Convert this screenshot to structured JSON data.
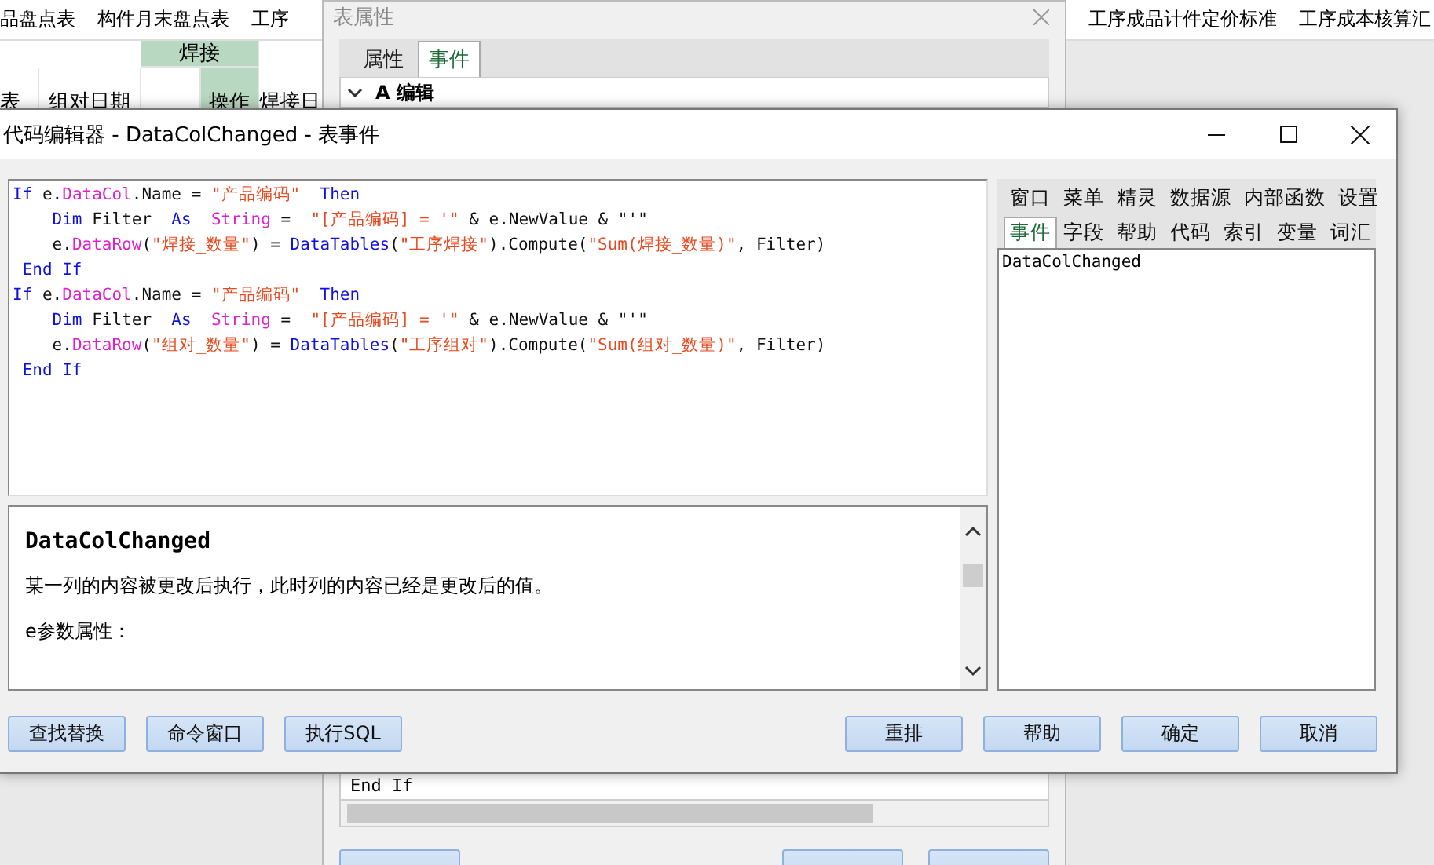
{
  "app_tabs": [
    "品盘点表",
    "构件月末盘点表",
    "工序",
    "工序成品计件定价标准",
    "工序成本核算汇"
  ],
  "grid_header": {
    "group": "焊接",
    "left_cut": "表",
    "col_date": "组对日期",
    "op": "操作",
    "weld_date": "焊接日"
  },
  "back_dialog": {
    "title": "表属性",
    "tabs": [
      {
        "label": "属性",
        "selected": false
      },
      {
        "label": "事件",
        "selected": true
      }
    ],
    "tree_item": "A 编辑",
    "code_tail": "End If"
  },
  "editor": {
    "title": "代码编辑器 - DataColChanged - 表事件",
    "code_lines": [
      [
        {
          "kind": "kw",
          "text": "If"
        },
        {
          "kind": "plain",
          "text": " e."
        },
        {
          "kind": "member",
          "text": "DataCol"
        },
        {
          "kind": "plain",
          "text": ".Name = "
        },
        {
          "kind": "str",
          "text": "\"产品编码\""
        },
        {
          "kind": "kw",
          "text": "  Then"
        }
      ],
      [
        {
          "kind": "kw",
          "text": "    Dim"
        },
        {
          "kind": "plain",
          "text": " Filter  "
        },
        {
          "kind": "kw",
          "text": "As"
        },
        {
          "kind": "member",
          "text": "  String"
        },
        {
          "kind": "plain",
          "text": " =  "
        },
        {
          "kind": "str",
          "text": "\"[产品编码] = '\""
        },
        {
          "kind": "plain",
          "text": " & e.NewValue & \"'\""
        }
      ],
      [
        {
          "kind": "plain",
          "text": "    e."
        },
        {
          "kind": "member",
          "text": "DataRow"
        },
        {
          "kind": "plain",
          "text": "("
        },
        {
          "kind": "str",
          "text": "\"焊接_数量\""
        },
        {
          "kind": "plain",
          "text": ") = "
        },
        {
          "kind": "kw",
          "text": "DataTables"
        },
        {
          "kind": "plain",
          "text": "("
        },
        {
          "kind": "str",
          "text": "\"工序焊接\""
        },
        {
          "kind": "plain",
          "text": ").Compute("
        },
        {
          "kind": "str",
          "text": "\"Sum(焊接_数量)\""
        },
        {
          "kind": "plain",
          "text": ", Filter)"
        }
      ],
      [
        {
          "kind": "kw",
          "text": " End If"
        }
      ],
      [
        {
          "kind": "kw",
          "text": "If"
        },
        {
          "kind": "plain",
          "text": " e."
        },
        {
          "kind": "member",
          "text": "DataCol"
        },
        {
          "kind": "plain",
          "text": ".Name = "
        },
        {
          "kind": "str",
          "text": "\"产品编码\""
        },
        {
          "kind": "kw",
          "text": "  Then"
        }
      ],
      [
        {
          "kind": "kw",
          "text": "    Dim"
        },
        {
          "kind": "plain",
          "text": " Filter  "
        },
        {
          "kind": "kw",
          "text": "As"
        },
        {
          "kind": "member",
          "text": "  String"
        },
        {
          "kind": "plain",
          "text": " =  "
        },
        {
          "kind": "str",
          "text": "\"[产品编码] = '\""
        },
        {
          "kind": "plain",
          "text": " & e.NewValue & \"'\""
        }
      ],
      [
        {
          "kind": "plain",
          "text": "    e."
        },
        {
          "kind": "member",
          "text": "DataRow"
        },
        {
          "kind": "plain",
          "text": "("
        },
        {
          "kind": "str",
          "text": "\"组对_数量\""
        },
        {
          "kind": "plain",
          "text": ") = "
        },
        {
          "kind": "kw",
          "text": "DataTables"
        },
        {
          "kind": "plain",
          "text": "("
        },
        {
          "kind": "str",
          "text": "\"工序组对\""
        },
        {
          "kind": "plain",
          "text": ").Compute("
        },
        {
          "kind": "str",
          "text": "\"Sum(组对_数量)\""
        },
        {
          "kind": "plain",
          "text": ", Filter)"
        }
      ],
      [
        {
          "kind": "kw",
          "text": " End If"
        }
      ]
    ],
    "help": {
      "title": "DataColChanged",
      "description": "某一列的内容被更改后执行，此时列的内容已经是更改后的值。",
      "section": "e参数属性："
    },
    "side_tabs_row1": [
      {
        "label": "窗口",
        "selected": false
      },
      {
        "label": "菜单",
        "selected": false
      },
      {
        "label": "精灵",
        "selected": false
      },
      {
        "label": "数据源",
        "selected": false
      },
      {
        "label": "内部函数",
        "selected": false
      },
      {
        "label": "设置",
        "selected": false
      }
    ],
    "side_tabs_row2": [
      {
        "label": "事件",
        "selected": true
      },
      {
        "label": "字段",
        "selected": false
      },
      {
        "label": "帮助",
        "selected": false
      },
      {
        "label": "代码",
        "selected": false
      },
      {
        "label": "索引",
        "selected": false
      },
      {
        "label": "变量",
        "selected": false
      },
      {
        "label": "词汇",
        "selected": false
      }
    ],
    "side_list": [
      "DataColChanged"
    ],
    "left_buttons": [
      "查找替换",
      "命令窗口",
      "执行SQL"
    ],
    "right_buttons": [
      "重排",
      "帮助",
      "确定",
      "取消"
    ]
  }
}
